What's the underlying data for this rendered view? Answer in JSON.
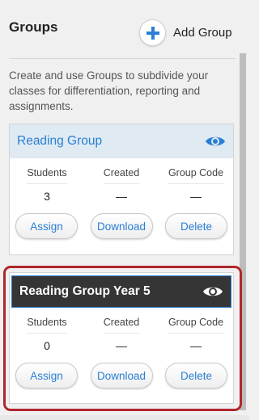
{
  "header": {
    "title": "Groups",
    "add_label": "Add Group"
  },
  "description": "Create and use Groups to subdivide your classes for differentiation, reporting and assignments.",
  "groups": [
    {
      "name": "Reading Group",
      "stats": {
        "students_label": "Students",
        "students": "3",
        "created_label": "Created",
        "created": "—",
        "code_label": "Group Code",
        "code": "—"
      },
      "actions": {
        "assign": "Assign",
        "download": "Download",
        "delete": "Delete"
      }
    },
    {
      "name": "Reading Group Year 5",
      "stats": {
        "students_label": "Students",
        "students": "0",
        "created_label": "Created",
        "created": "—",
        "code_label": "Group Code",
        "code": "—"
      },
      "actions": {
        "assign": "Assign",
        "download": "Download",
        "delete": "Delete"
      }
    }
  ],
  "icons": {
    "add": "plus-icon",
    "visibility": "eye-icon"
  },
  "colors": {
    "accent": "#2a7fd4",
    "selected_header": "#353535",
    "highlight": "#b0262c"
  }
}
